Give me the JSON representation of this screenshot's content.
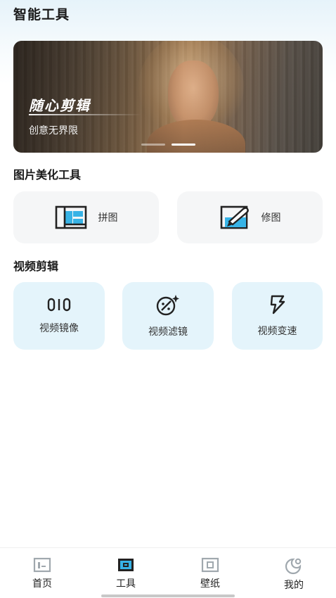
{
  "header": {
    "title": "智能工具"
  },
  "banner": {
    "title": "随心剪辑",
    "subtitle": "创意无界限",
    "pages": 2,
    "active_page": 2
  },
  "photo_tools": {
    "title": "图片美化工具",
    "items": [
      {
        "label": "拼图",
        "icon": "collage-icon"
      },
      {
        "label": "修图",
        "icon": "photo-edit-icon"
      }
    ]
  },
  "video_tools": {
    "title": "视频剪辑",
    "items": [
      {
        "label": "视频镜像",
        "icon": "mirror-icon"
      },
      {
        "label": "视频滤镜",
        "icon": "filter-icon"
      },
      {
        "label": "视频变速",
        "icon": "speed-icon"
      }
    ]
  },
  "bottom_nav": {
    "items": [
      {
        "label": "首页",
        "icon": "home-icon"
      },
      {
        "label": "工具",
        "icon": "tools-icon",
        "active": true
      },
      {
        "label": "壁纸",
        "icon": "wallpaper-icon"
      },
      {
        "label": "我的",
        "icon": "profile-icon"
      }
    ]
  },
  "colors": {
    "accent": "#37b3e6",
    "dark": "#222222",
    "card_gray": "#f5f6f7",
    "card_blue": "#e4f4fb"
  }
}
